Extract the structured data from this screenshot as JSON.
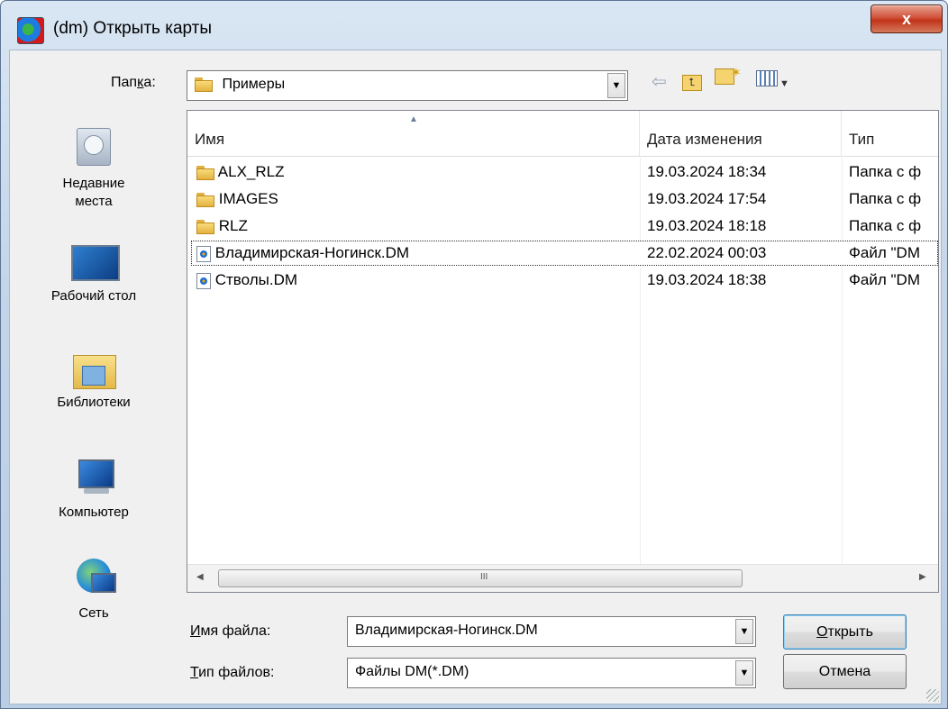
{
  "window": {
    "title": "(dm) Открыть карты",
    "close_symbol": "x"
  },
  "folder_bar": {
    "label_pre": "Пап",
    "label_u": "к",
    "label_post": "а:",
    "current_folder": "Примеры",
    "icons": [
      "back-arrow-icon",
      "up-folder-icon",
      "new-folder-icon",
      "view-menu-icon"
    ]
  },
  "places": [
    {
      "label": "Недавние места",
      "icon": "recent-places-icon"
    },
    {
      "label": "Рабочий стол",
      "icon": "desktop-icon"
    },
    {
      "label": "Библиотеки",
      "icon": "libraries-icon"
    },
    {
      "label": "Компьютер",
      "icon": "computer-icon"
    },
    {
      "label": "Сеть",
      "icon": "network-icon"
    }
  ],
  "columns": {
    "name": "Имя",
    "date": "Дата изменения",
    "type": "Тип"
  },
  "files": [
    {
      "name": "ALX_RLZ",
      "date": "19.03.2024 18:34",
      "type": "Папка с ф",
      "kind": "folder"
    },
    {
      "name": "IMAGES",
      "date": "19.03.2024 17:54",
      "type": "Папка с ф",
      "kind": "folder"
    },
    {
      "name": "RLZ",
      "date": "19.03.2024 18:18",
      "type": "Папка с ф",
      "kind": "folder"
    },
    {
      "name": "Владимирская-Ногинск.DM",
      "date": "22.02.2024 00:03",
      "type": "Файл \"DM",
      "kind": "file",
      "selected": true
    },
    {
      "name": "Стволы.DM",
      "date": "19.03.2024 18:38",
      "type": "Файл \"DM",
      "kind": "file"
    }
  ],
  "scrollbar": {
    "grip": "III"
  },
  "filename": {
    "label_u": "И",
    "label_rest": "мя файла:",
    "value": "Владимирская-Ногинск.DM"
  },
  "filetype": {
    "label_u": "Т",
    "label_rest": "ип файлов:",
    "value": "Файлы DM(*.DM)"
  },
  "buttons": {
    "open_u": "О",
    "open_rest": "ткрыть",
    "cancel": "Отмена"
  },
  "colors": {
    "titlebar": "#c3d5e9",
    "close": "#c13319",
    "selection_outline": "#333333"
  }
}
